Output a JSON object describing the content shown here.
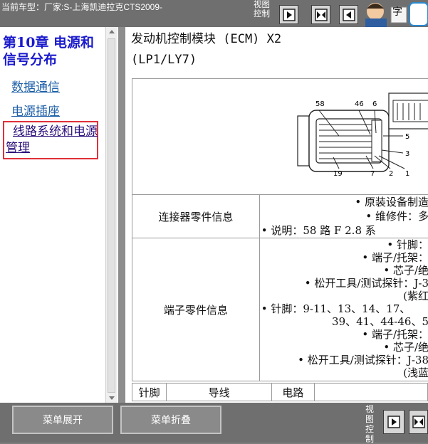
{
  "header": {
    "vehicle_text": "当前车型：厂家:S-上海凯迪拉克CTS2009-",
    "view_control_label": "视图控制",
    "mascot_text": "字"
  },
  "sidebar": {
    "chapter_title": "第10章  电源和信号分布",
    "links": [
      {
        "label": "数据通信"
      },
      {
        "label": "电源插座"
      }
    ],
    "selected_link": {
      "label": "线路系统和电源管理"
    }
  },
  "content": {
    "title_line1": "发动机控制模块 (ECM) X2",
    "title_line2": "(LP1/LY7)",
    "diagram_labels": [
      "58",
      "46",
      "6",
      "5",
      "3",
      "1",
      "2",
      "7",
      "19"
    ],
    "connector_info": {
      "label": "连接器零件信息",
      "lines": [
        "• 原装设备制造",
        "• 维修件：多",
        "• 说明：58 路 F 2.8 系"
      ]
    },
    "terminal_info": {
      "label": "端子零件信息",
      "lines": [
        "• 针脚：",
        "• 端子/托架：",
        "• 芯子/绝",
        "• 松开工具/测试探针：J-3",
        "(紫红",
        "• 针脚：9-11、13、14、17、",
        "39、41、44-46、5",
        "• 端子/托架：",
        "• 芯子/绝",
        "• 松开工具/测试探针：J-38",
        "(浅蓝"
      ]
    },
    "table_headers": [
      "针脚",
      "导线",
      "电路"
    ]
  },
  "footer": {
    "expand_label": "菜单展开",
    "collapse_label": "菜单折叠",
    "view_control_label": "视图控制"
  }
}
